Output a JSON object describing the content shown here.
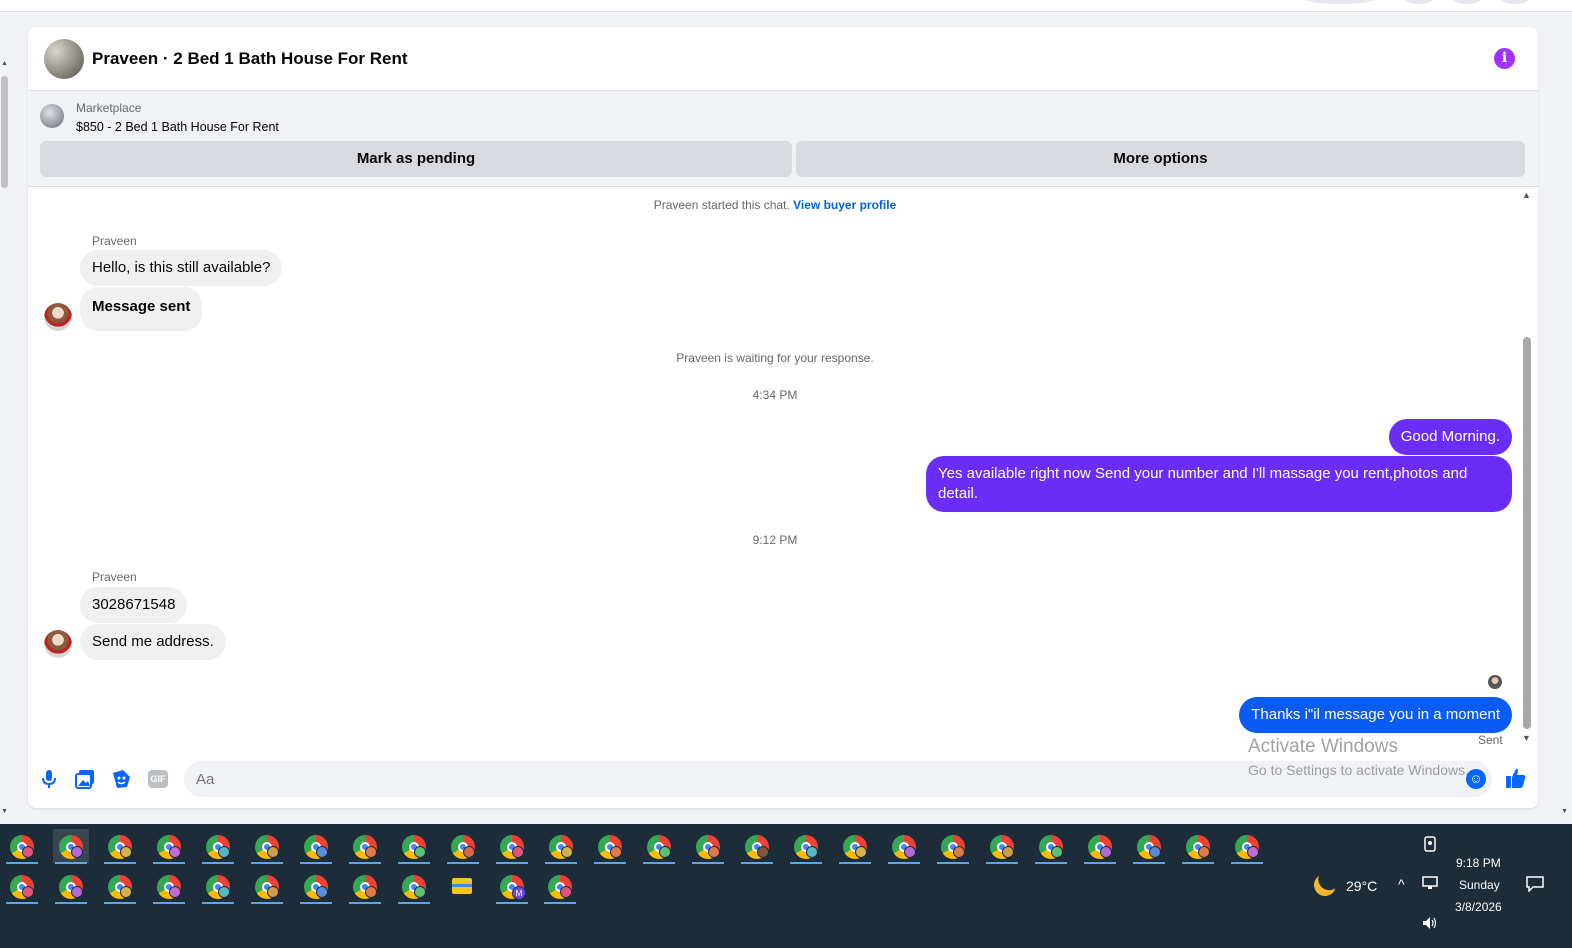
{
  "conversation": {
    "title": "Praveen · 2 Bed 1 Bath House For Rent",
    "info_icon": "info-icon"
  },
  "listing": {
    "label": "Marketplace",
    "description": "$850 - 2 Bed 1 Bath House For Rent",
    "mark_pending_label": "Mark as pending",
    "more_options_label": "More options"
  },
  "chat": {
    "started_text": "Praveen started this chat.",
    "buyer_profile_link": "View buyer profile",
    "waiting_text": "Praveen is waiting for your response.",
    "time_1": "4:34 PM",
    "time_2": "9:12 PM",
    "sender_name": "Praveen",
    "msg_1": "Hello, is this still available?",
    "msg_2": "Message sent",
    "msg_3": "Good Morning.",
    "msg_4": "Yes available right now Send your number and I'll massage you rent,photos and detail.",
    "msg_5": "3028671548",
    "msg_6": "Send me address.",
    "msg_7": "Thanks i\"il message you in a moment",
    "status": "Sent"
  },
  "composer": {
    "placeholder": "Aa",
    "gif_label": "GIF"
  },
  "watermark": {
    "line1": "Activate Windows",
    "line2": "Go to Settings to activate Windows."
  },
  "taskbar": {
    "weather": "29°C",
    "time": "9:18 PM",
    "day": "Sunday",
    "date": "3/8/2026",
    "profile_letter": "M"
  },
  "colors": {
    "outgoing_purple": "#6b2cf5",
    "outgoing_blue": "#0a5cf4",
    "accent": "#0866ff",
    "info": "#a033ff",
    "taskbar": "#1c2c38"
  }
}
